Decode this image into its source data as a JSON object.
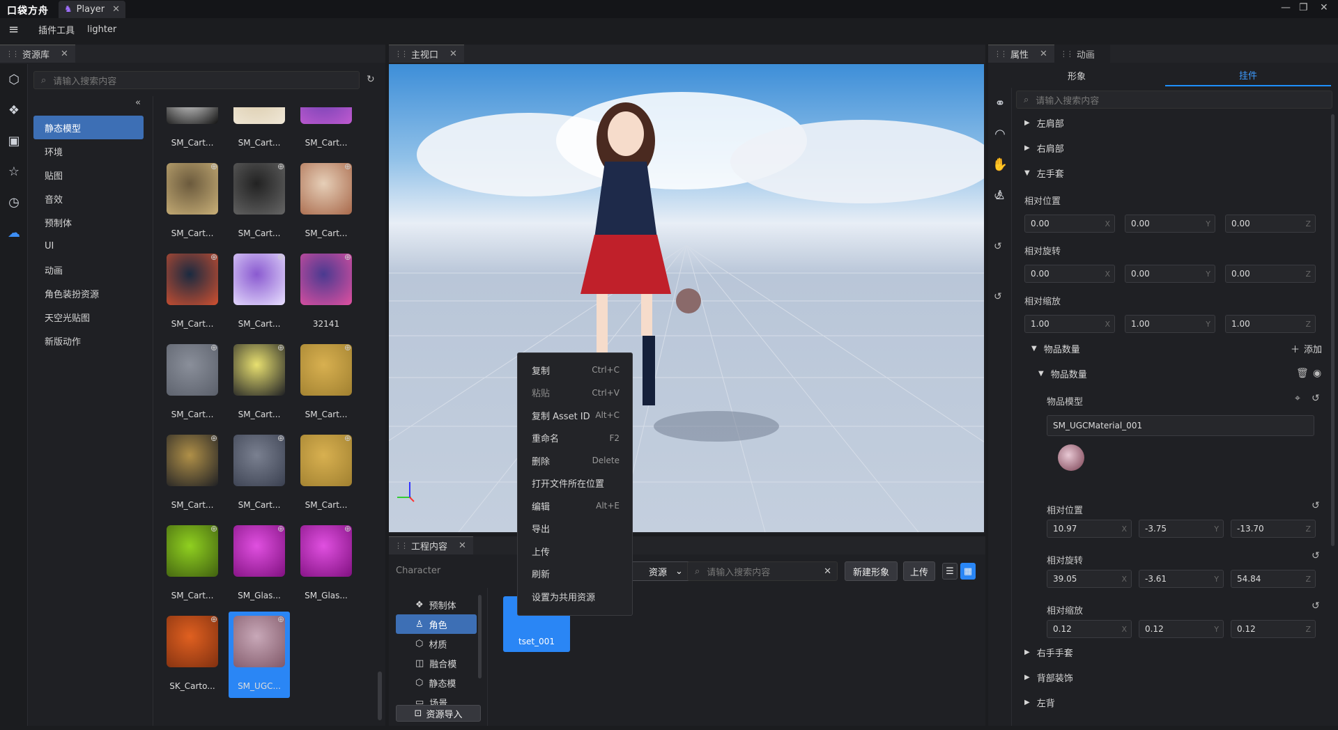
{
  "app": {
    "logo": "口袋方舟",
    "tab_title": "Player",
    "close": "✕"
  },
  "window_controls": [
    "—",
    "❐",
    "✕"
  ],
  "menubar": {
    "menu_icon": "≡",
    "items": [
      "插件工具",
      "lighter"
    ]
  },
  "asset_panel": {
    "tab": "资源库",
    "search_placeholder": "请输入搜索内容",
    "categories": [
      "静态模型",
      "环境",
      "贴图",
      "音效",
      "预制体",
      "UI",
      "动画",
      "角色装扮资源",
      "天空光贴图",
      "新版动作"
    ],
    "active_category": 0,
    "assets": [
      {
        "label": "SM_Cart...",
        "color": "#f2f2f2",
        "alt": "#111"
      },
      {
        "label": "SM_Cart...",
        "color": "#d9c9a8",
        "alt": "#f0e8d8"
      },
      {
        "label": "SM_Cart...",
        "color": "#6a3fb0",
        "alt": "#c05ad0"
      },
      {
        "label": "SM_Cart...",
        "color": "#6b5a3d",
        "alt": "#c9b078"
      },
      {
        "label": "SM_Cart...",
        "color": "#222",
        "alt": "#666"
      },
      {
        "label": "SM_Cart...",
        "color": "#e6cfb8",
        "alt": "#a8684a"
      },
      {
        "label": "SM_Cart...",
        "color": "#1a2a40",
        "alt": "#d05030"
      },
      {
        "label": "SM_Cart...",
        "color": "#8a5ad0",
        "alt": "#e8e0ff"
      },
      {
        "label": "32141",
        "color": "#4a3a90",
        "alt": "#e050a0"
      },
      {
        "label": "SM_Cart...",
        "color": "#8a8f9a",
        "alt": "#5a5f6a"
      },
      {
        "label": "SM_Cart...",
        "color": "#e8e070",
        "alt": "#1f2024"
      },
      {
        "label": "SM_Cart...",
        "color": "#d8b050",
        "alt": "#a08030"
      },
      {
        "label": "SM_Cart...",
        "color": "#b09048",
        "alt": "#1f2024"
      },
      {
        "label": "SM_Cart...",
        "color": "#7a8090",
        "alt": "#3a4050"
      },
      {
        "label": "SM_Cart...",
        "color": "#d8b050",
        "alt": "#a08030"
      },
      {
        "label": "SM_Cart...",
        "color": "#90d020",
        "alt": "#406010"
      },
      {
        "label": "SM_Glas...",
        "color": "#e050e0",
        "alt": "#801080"
      },
      {
        "label": "SM_Glas...",
        "color": "#e050e0",
        "alt": "#801080"
      },
      {
        "label": "SK_Carto...",
        "color": "#e06020",
        "alt": "#803010"
      },
      {
        "label": "SM_UGC...",
        "color": "#c8a8b8",
        "alt": "#805868"
      }
    ],
    "selected_asset": 19
  },
  "viewport": {
    "tab": "主视口"
  },
  "context_menu": [
    {
      "label": "复制",
      "key": "Ctrl+C",
      "disabled": false
    },
    {
      "label": "粘贴",
      "key": "Ctrl+V",
      "disabled": true
    },
    {
      "label": "复制 Asset ID",
      "key": "Alt+C",
      "disabled": false
    },
    {
      "label": "重命名",
      "key": "F2",
      "disabled": false
    },
    {
      "label": "删除",
      "key": "Delete",
      "disabled": false
    },
    {
      "label": "打开文件所在位置",
      "key": "",
      "disabled": false
    },
    {
      "label": "编辑",
      "key": "Alt+E",
      "disabled": false
    },
    {
      "label": "导出",
      "key": "",
      "disabled": false
    },
    {
      "label": "上传",
      "key": "",
      "disabled": false
    },
    {
      "label": "刷新",
      "key": "",
      "disabled": false
    },
    {
      "label": "设置为共用资源",
      "key": "",
      "disabled": false
    }
  ],
  "project_panel": {
    "tab": "工程内容",
    "path": "Character",
    "filter_label": "资源",
    "search_placeholder": "请输入搜索内容",
    "new_button": "新建形象",
    "upload_button": "上传",
    "tree": [
      "预制体",
      "角色",
      "材质",
      "融合模",
      "静态模",
      "场景"
    ],
    "active_tree": 1,
    "import_button": "资源导入",
    "item_label": "tset_001"
  },
  "properties_panel": {
    "tabs": [
      "属性",
      "动画"
    ],
    "subtabs": [
      "形象",
      "挂件"
    ],
    "active_subtab": 1,
    "search_placeholder": "请输入搜索内容",
    "sections_top": [
      "左肩部",
      "右肩部"
    ],
    "expanded": "左手套",
    "rel_pos_label": "相对位置",
    "rel_rot_label": "相对旋转",
    "rel_scale_label": "相对缩放",
    "pos": [
      "0.00",
      "0.00",
      "0.00"
    ],
    "rot": [
      "0.00",
      "0.00",
      "0.00"
    ],
    "scale": [
      "1.00",
      "1.00",
      "1.00"
    ],
    "axes": [
      "X",
      "Y",
      "Z"
    ],
    "item_count_label": "物品数量",
    "add_label": "添加",
    "item_label": "物品数量",
    "item_model_label": "物品模型",
    "model_name": "SM_UGCMaterial_001",
    "item_pos": [
      "10.97",
      "-3.75",
      "-13.70"
    ],
    "item_rot": [
      "39.05",
      "-3.61",
      "54.84"
    ],
    "item_scale": [
      "0.12",
      "0.12",
      "0.12"
    ],
    "sections_bottom": [
      "右手手套",
      "背部装饰",
      "左背"
    ]
  },
  "colors": {
    "accent": "#3d6fb5",
    "selection": "#2a86f5",
    "tab_active": "#1e90ff"
  }
}
